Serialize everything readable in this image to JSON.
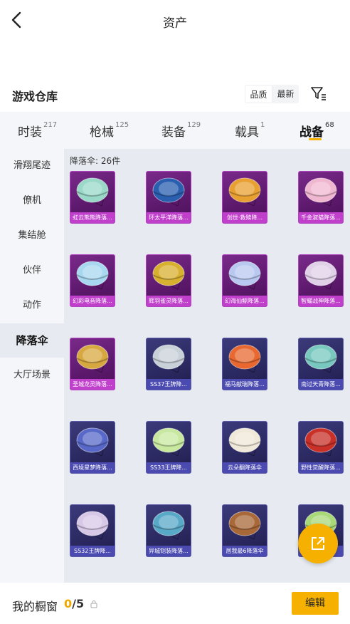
{
  "header": {
    "title": "资产",
    "back_icon": "chevron-left-icon"
  },
  "warehouse": {
    "title": "游戏仓库",
    "sort_options": [
      "品质",
      "最新"
    ],
    "sort_selected": "品质",
    "filter_icon": "filter-icon"
  },
  "tabs": [
    {
      "label": "时装",
      "count": "217"
    },
    {
      "label": "枪械",
      "count": "125"
    },
    {
      "label": "装备",
      "count": "129"
    },
    {
      "label": "载具",
      "count": "1"
    },
    {
      "label": "战备",
      "count": "68",
      "active": true
    }
  ],
  "sidebar": [
    {
      "label": "滑翔尾迹"
    },
    {
      "label": "僚机"
    },
    {
      "label": "集结舱"
    },
    {
      "label": "伙伴"
    },
    {
      "label": "动作"
    },
    {
      "label": "降落伞",
      "active": true
    },
    {
      "label": "大厅场景"
    }
  ],
  "grid": {
    "count_label": "降落伞: 26件",
    "items": [
      {
        "name": "虹云熊熊降落...",
        "rarity": "purple",
        "color": "#9ad8c8"
      },
      {
        "name": "环太平洋降落...",
        "rarity": "purple",
        "color": "#2a5fb0"
      },
      {
        "name": "创世·救赎降...",
        "rarity": "purple",
        "color": "#e8a030"
      },
      {
        "name": "千金淑猫降落...",
        "rarity": "purple",
        "color": "#f0b8d0"
      },
      {
        "name": "幻彩电音降落...",
        "rarity": "purple",
        "color": "#a8d8f0"
      },
      {
        "name": "辉羽雀灵降落...",
        "rarity": "purple",
        "color": "#d8b030"
      },
      {
        "name": "幻海仙鲸降落...",
        "rarity": "purple",
        "color": "#b8c8f0"
      },
      {
        "name": "智耀战神降落...",
        "rarity": "purple",
        "color": "#e0d0e8"
      },
      {
        "name": "圣城龙灵降落...",
        "rarity": "purple",
        "color": "#d8a840"
      },
      {
        "name": "SS37王牌降...",
        "rarity": "blue",
        "color": "#c8d0d8"
      },
      {
        "name": "福马献瑞降落...",
        "rarity": "blue",
        "color": "#e86830"
      },
      {
        "name": "南过天青降落...",
        "rarity": "blue",
        "color": "#78c8c0"
      },
      {
        "name": "西境星梦降落...",
        "rarity": "blue",
        "color": "#5868c8"
      },
      {
        "name": "SS33王牌降...",
        "rarity": "blue",
        "color": "#c8e8a0"
      },
      {
        "name": "云朵翻降落伞",
        "rarity": "blue",
        "color": "#f0e8d8"
      },
      {
        "name": "野性觉醒降落...",
        "rarity": "blue",
        "color": "#c83028"
      },
      {
        "name": "SS32王牌降...",
        "rarity": "blue",
        "color": "#d8c8e8"
      },
      {
        "name": "异城铠装降落...",
        "rarity": "blue",
        "color": "#58a8c8"
      },
      {
        "name": "居我最6降落伞",
        "rarity": "blue",
        "color": "#a86838"
      },
      {
        "name": "",
        "rarity": "blue",
        "color": "#a8d878"
      }
    ]
  },
  "fab": {
    "icon": "share-icon"
  },
  "showcase": {
    "label": "我的橱窗",
    "current": "0",
    "total": "/5",
    "edit_label": "编辑",
    "lock_icon": "lock-icon"
  },
  "colors": {
    "accent": "#f6b100",
    "purple_rarity": "#c040cc",
    "blue_rarity": "#4a4ab0"
  }
}
